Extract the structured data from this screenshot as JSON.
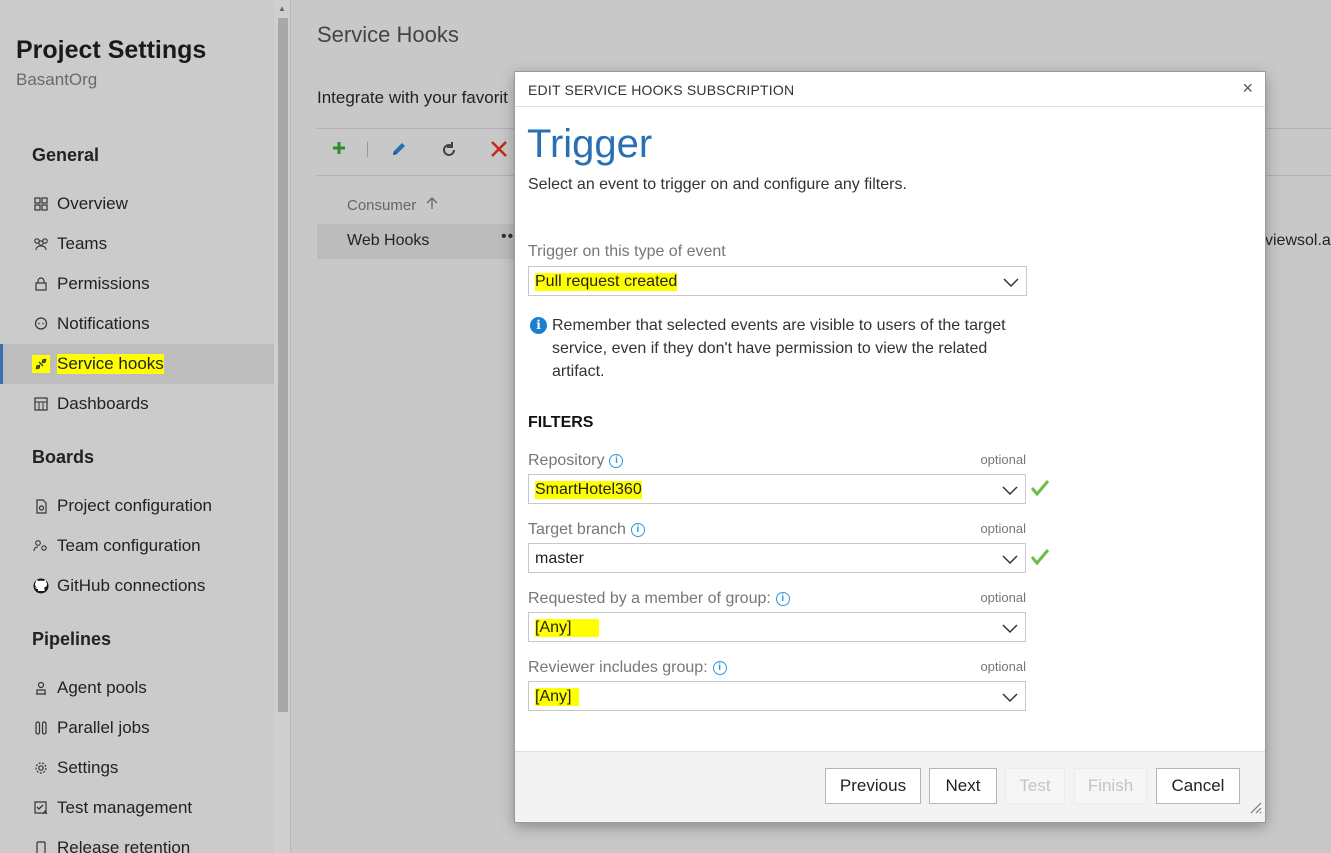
{
  "sidebar": {
    "title": "Project Settings",
    "org": "BasantOrg",
    "sections": {
      "general": "General",
      "boards": "Boards",
      "pipelines": "Pipelines"
    },
    "general_items": {
      "overview": "Overview",
      "teams": "Teams",
      "permissions": "Permissions",
      "notifications": "Notifications",
      "service_hooks": "Service hooks",
      "dashboards": "Dashboards"
    },
    "boards_items": {
      "project_configuration": "Project configuration",
      "team_configuration": "Team configuration",
      "github_connections": "GitHub connections"
    },
    "pipelines_items": {
      "agent_pools": "Agent pools",
      "parallel_jobs": "Parallel jobs",
      "settings": "Settings",
      "test_management": "Test management",
      "release_retention": "Release retention"
    },
    "selected": "Service hooks"
  },
  "main": {
    "title": "Service Hooks",
    "subtitle": "Integrate with your favorit",
    "table": {
      "column_consumer": "Consumer",
      "row_consumer": "Web Hooks",
      "row_more": "••",
      "row_url_fragment": "viewsol.a"
    }
  },
  "dialog": {
    "header": "EDIT SERVICE HOOKS SUBSCRIPTION",
    "close": "×",
    "title": "Trigger",
    "description": "Select an event to trigger on and configure any filters.",
    "event_label": "Trigger on this type of event",
    "event_value": "Pull request created",
    "notice": "Remember that selected events are visible to users of the target service, even if they don't have permission to view the related artifact.",
    "filters_heading": "FILTERS",
    "optional": "optional",
    "filters": {
      "repository": {
        "label": "Repository",
        "value": "SmartHotel360"
      },
      "target_branch": {
        "label": "Target branch",
        "value": "master"
      },
      "requested_by": {
        "label": "Requested by a member of group:",
        "value": "[Any]"
      },
      "reviewer": {
        "label": "Reviewer includes group:",
        "value": "[Any]"
      }
    },
    "buttons": {
      "previous": "Previous",
      "next": "Next",
      "test": "Test",
      "finish": "Finish",
      "cancel": "Cancel"
    }
  },
  "colors": {
    "highlight": "#ffff00",
    "title_blue": "#2a6fb4",
    "info_blue": "#2f9ad6",
    "check_green": "#6cbd45",
    "add_green": "#2e8b2e",
    "delete_red": "#c8281e"
  }
}
